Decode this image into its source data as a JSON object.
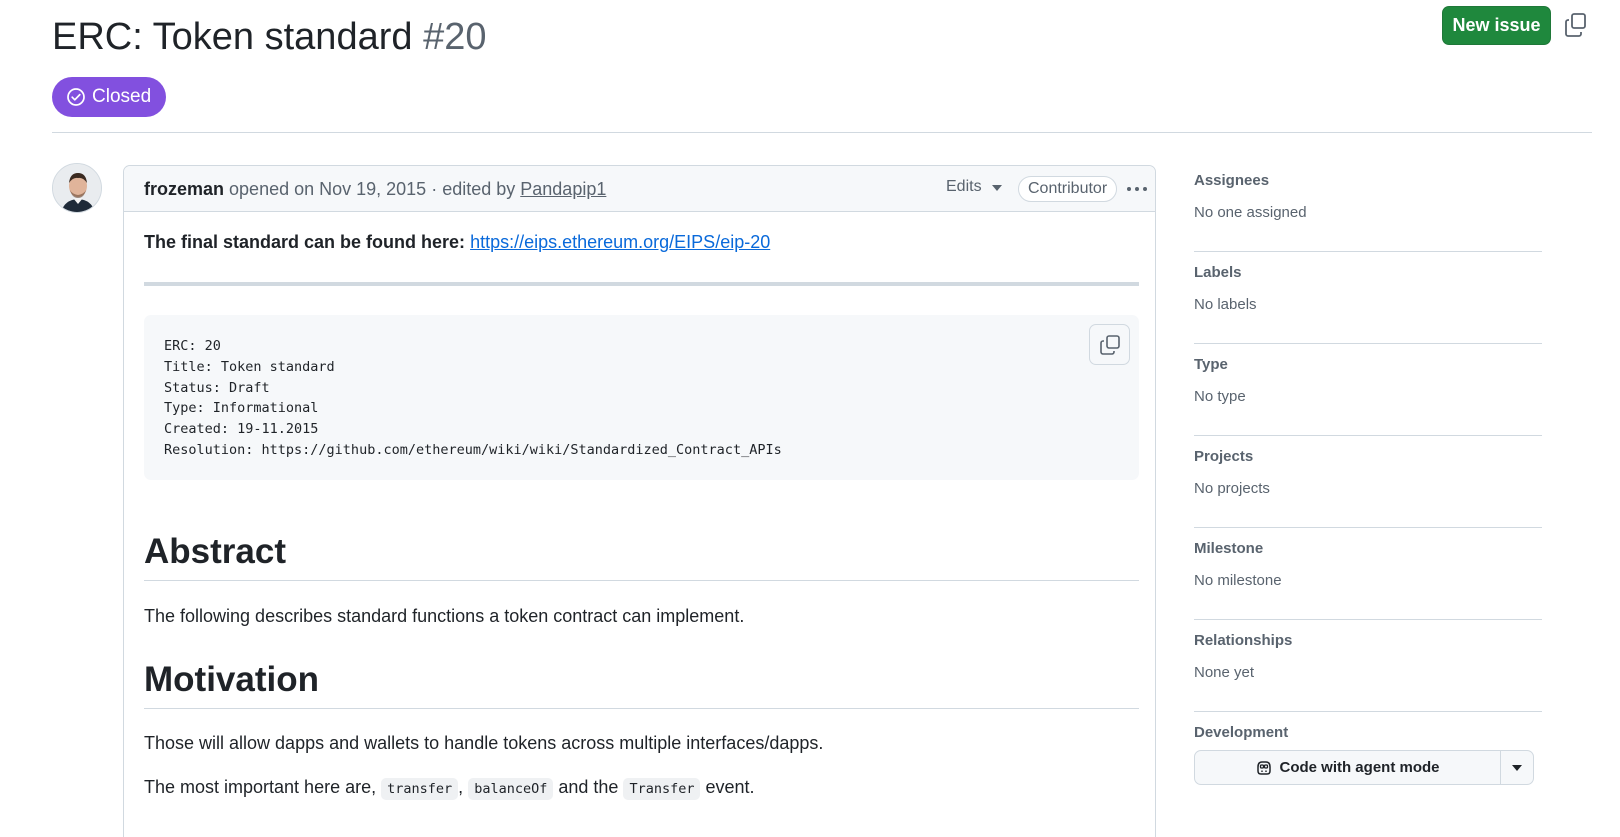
{
  "issue": {
    "title": "ERC: Token standard",
    "number": "#20",
    "state": "Closed",
    "new_issue_label": "New issue"
  },
  "comment": {
    "author": "frozeman",
    "opened_text": "opened on Nov 19, 2015 · edited by",
    "editor": "Pandapip1",
    "edits_label": "Edits",
    "role_badge": "Contributor",
    "intro_text": "The final standard can be found here:",
    "intro_link": "https://eips.ethereum.org/EIPS/eip-20",
    "code_block": "ERC: 20\nTitle: Token standard\nStatus: Draft\nType: Informational\nCreated: 19-11.2015\nResolution: https://github.com/ethereum/wiki/wiki/Standardized_Contract_APIs",
    "abstract_heading": "Abstract",
    "abstract_text": "The following describes standard functions a token contract can implement.",
    "motivation_heading": "Motivation",
    "motivation_text": "Those will allow dapps and wallets to handle tokens across multiple interfaces/dapps.",
    "important_prefix": "The most important here are,",
    "code_transfer": "transfer",
    "sep_comma": ",",
    "code_balanceof": "balanceOf",
    "and_the": "and the",
    "code_transfer_event": "Transfer",
    "event_suffix": "event."
  },
  "sidebar": {
    "sections": [
      {
        "title": "Assignees",
        "value": "No one assigned"
      },
      {
        "title": "Labels",
        "value": "No labels"
      },
      {
        "title": "Type",
        "value": "No type"
      },
      {
        "title": "Projects",
        "value": "No projects"
      },
      {
        "title": "Milestone",
        "value": "No milestone"
      },
      {
        "title": "Relationships",
        "value": "None yet"
      }
    ],
    "development": {
      "title": "Development",
      "button_label": "Code with agent mode"
    }
  },
  "colors": {
    "closed_badge": "#8250df",
    "new_issue_button": "#1f883d",
    "link": "#0969da"
  },
  "icons": [
    "check-circle-icon",
    "copy-icon",
    "kebab-horizontal-icon",
    "triangle-down-icon",
    "copilot-icon"
  ]
}
